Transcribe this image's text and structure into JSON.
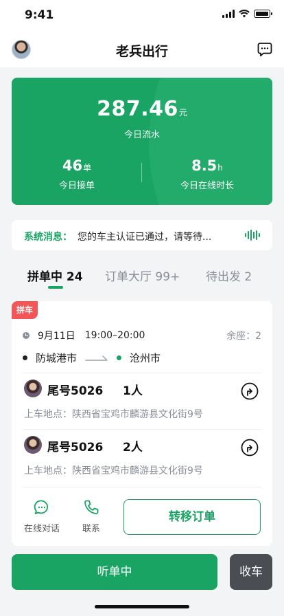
{
  "status_bar": {
    "time": "9:41"
  },
  "header": {
    "title": "老兵出行"
  },
  "earnings": {
    "revenue_value": "287.46",
    "revenue_unit": "元",
    "revenue_label": "今日流水",
    "orders_value": "46",
    "orders_unit": "单",
    "orders_label": "今日接单",
    "online_value": "8.5",
    "online_unit": "h",
    "online_label": "今日在线时长"
  },
  "notice": {
    "prefix": "系统消息：",
    "text": "您的车主认证已通过，请等待..."
  },
  "tabs": [
    {
      "label": "拼单中 24",
      "active": true
    },
    {
      "label": "订单大厅 99+",
      "active": false
    },
    {
      "label": "待出发 2",
      "active": false
    }
  ],
  "order": {
    "badge": "拼车",
    "date": "9月11日",
    "time_range": "19:00–20:00",
    "seats": "余座：2",
    "from_city": "防城港市",
    "to_city": "沧州市",
    "passengers": [
      {
        "name": "尾号5026",
        "count": "1人",
        "pickup_label": "上车地点：",
        "pickup": "陕西省宝鸡市麟游县文化街9号"
      },
      {
        "name": "尾号5026",
        "count": "2人",
        "pickup_label": "上车地点：",
        "pickup": "陕西省宝鸡市麟游县文化街9号"
      }
    ],
    "actions": {
      "chat_label": "在线对话",
      "contact_label": "联系",
      "transfer_label": "转移订单"
    }
  },
  "bottom": {
    "listen_label": "听单中",
    "stop_label": "收车"
  },
  "colors": {
    "primary": "#19a464",
    "badge": "#f25757",
    "stop": "#4a4d52"
  }
}
